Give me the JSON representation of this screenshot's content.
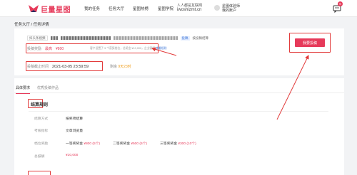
{
  "header": {
    "logo_text": "巨量星图",
    "nav": [
      "我的任务",
      "任务大厅",
      "星图热榜",
      "星图学院"
    ],
    "watermark_line1": "人人都是互联网",
    "watermark_line2": "iwoshizmt.cn",
    "user_line1": "星图体验师",
    "user_line2": "我的账户",
    "notification_count": "6"
  },
  "breadcrumb": "任务大厅 / 任务详情",
  "task": {
    "platform_tag": "抖头条视频",
    "chip": "投稿",
    "chip2": "按投稿结算",
    "reward_label": "投稿奖励",
    "reward_prefix": "最高",
    "reward_amount": "¥800",
    "reward_note": "客户设置了 3 个获奖档位，总奖金 ¥10,000，企业客服",
    "reward_link": "查看规则",
    "deadline_label": "投稿截止时间",
    "deadline_value": "2021-03-05 23:59:59",
    "remaining_label": "剩余",
    "remaining_value": "9天23时"
  },
  "accept_button": "我要投稿",
  "tabs": [
    "具体要求",
    "优秀投稿作品"
  ],
  "settlement": {
    "title": "结算规则",
    "rows": [
      {
        "label": "结算方式",
        "value": "按奖项结算"
      },
      {
        "label": "考核指标",
        "value": "文章浏览量"
      },
      {
        "label": "总报酬",
        "value": "¥10,000"
      }
    ],
    "prize_label": "档位奖励",
    "prizes": [
      {
        "name": "一等奖奖金",
        "amount": "¥800 (5个)"
      },
      {
        "name": "二等奖奖金",
        "amount": "¥500 (6个)"
      },
      {
        "name": "三等奖奖金",
        "amount": "¥300 (10个)"
      }
    ]
  },
  "colors": {
    "accent": "#e63a5a",
    "highlight": "#e23b3b",
    "link": "#3b74d6"
  }
}
